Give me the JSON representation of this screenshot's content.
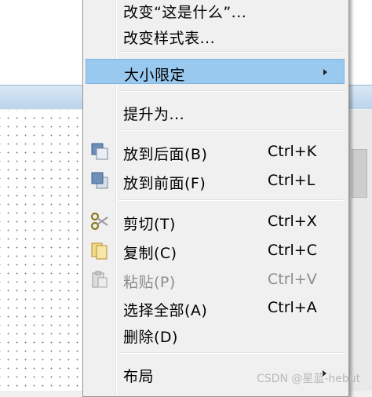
{
  "menu": {
    "items": [
      {
        "label": "改变“这是什么”...",
        "accel": ""
      },
      {
        "label": "改变样式表...",
        "accel": ""
      },
      {
        "label": "大小限定",
        "accel": ""
      },
      {
        "label": "提升为...",
        "accel": ""
      },
      {
        "label": "放到后面(B)",
        "accel": "Ctrl+K"
      },
      {
        "label": "放到前面(F)",
        "accel": "Ctrl+L"
      },
      {
        "label": "剪切(T)",
        "accel": "Ctrl+X"
      },
      {
        "label": "复制(C)",
        "accel": "Ctrl+C"
      },
      {
        "label": "粘贴(P)",
        "accel": "Ctrl+V"
      },
      {
        "label": "选择全部(A)",
        "accel": "Ctrl+A"
      },
      {
        "label": "删除(D)",
        "accel": ""
      },
      {
        "label": "布局",
        "accel": ""
      }
    ]
  },
  "watermark": "CSDN @星蓝-hebut",
  "colors": {
    "highlight": "#99c9ef",
    "menu_bg": "#f0f0f0",
    "disabled_text": "#8d8d8d"
  },
  "icons": [
    "send-to-back-icon",
    "bring-to-front-icon",
    "cut-scissors-icon",
    "copy-icon",
    "paste-icon",
    "submenu-arrow-icon"
  ]
}
